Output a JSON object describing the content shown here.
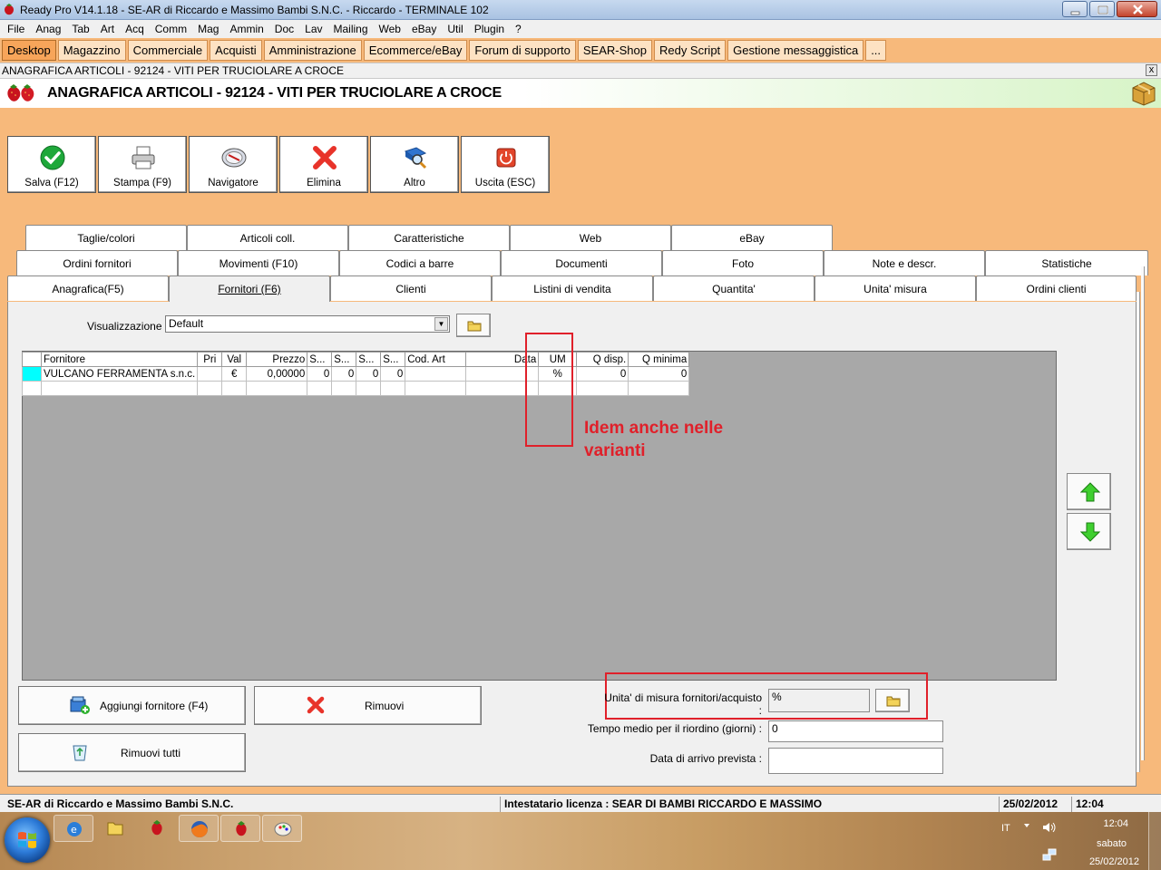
{
  "window": {
    "title": "Ready Pro V14.1.18 - SE-AR di Riccardo e Massimo Bambi S.N.C. - Riccardo - TERMINALE 102"
  },
  "menu": [
    "File",
    "Anag",
    "Tab",
    "Art",
    "Acq",
    "Comm",
    "Mag",
    "Ammin",
    "Doc",
    "Lav",
    "Mailing",
    "Web",
    "eBay",
    "Util",
    "Plugin",
    "?"
  ],
  "modules": [
    "Desktop",
    "Magazzino",
    "Commerciale",
    "Acquisti",
    "Amministrazione",
    "Ecommerce/eBay",
    "Forum di supporto",
    "SEAR-Shop",
    "Redy Script",
    "Gestione messaggistica",
    "..."
  ],
  "caption": {
    "text": "ANAGRAFICA ARTICOLI - 92124 - VITI PER TRUCIOLARE A CROCE",
    "close": "x"
  },
  "header": {
    "title": "ANAGRAFICA ARTICOLI - 92124 - VITI PER TRUCIOLARE A CROCE"
  },
  "toolbar": {
    "save": "Salva (F12)",
    "print": "Stampa (F9)",
    "navigator": "Navigatore",
    "delete": "Elimina",
    "other": "Altro",
    "exit": "Uscita (ESC)"
  },
  "tabs": {
    "row1": [
      "Taglie/colori",
      "Articoli coll.",
      "Caratteristiche",
      "Web",
      "eBay"
    ],
    "row2": [
      "Ordini fornitori",
      "Movimenti (F10)",
      "Codici a barre",
      "Documenti",
      "Foto",
      "Note e descr.",
      "Statistiche"
    ],
    "row3": [
      "Anagrafica(F5)",
      "Fornitori (F6)",
      "Clienti",
      "Listini di vendita",
      "Quantita'",
      "Unita' misura",
      "Ordini clienti"
    ]
  },
  "visualizzazione": {
    "label": "Visualizzazione :",
    "value": "Default",
    "arrow": "▼"
  },
  "grid": {
    "columns": [
      "Fornitore",
      "Pri",
      "Val",
      "Prezzo",
      "S...",
      "S...",
      "S...",
      "S...",
      "Cod. Art",
      "Data",
      "UM",
      "Q disp.",
      "Q minima"
    ],
    "rows": [
      [
        "VULCANO FERRAMENTA s.n.c.",
        "",
        "€",
        "0,00000",
        "0",
        "0",
        "0",
        "0",
        "",
        "",
        "%",
        "0",
        "0"
      ]
    ]
  },
  "annotation": {
    "line1": "Idem anche nelle",
    "line2": "varianti"
  },
  "buttons": {
    "add_supplier": "Aggiungi fornitore (F4)",
    "remove": "Rimuovi",
    "remove_all": "Rimuovi tutti"
  },
  "form": {
    "um_label": "Unita' di misura fornitori/acquisto :",
    "um_value": "%",
    "lead_label": "Tempo medio per il riordino (giorni) :",
    "lead_value": "0",
    "arrival_label": "Data di arrivo prevista :",
    "arrival_value": ""
  },
  "status": {
    "company": "SE-AR di Riccardo e Massimo Bambi S.N.C.",
    "license": "Intestatario licenza : SEAR DI BAMBI RICCARDO E MASSIMO",
    "date": "25/02/2012",
    "time": "12:04"
  },
  "taskbar": {
    "lang": "IT",
    "clock": "12:04",
    "day": "sabato",
    "date": "25/02/2012"
  },
  "colors": {
    "accent_orange": "#f7b97b",
    "annotation_red": "#e0202a",
    "selection_cyan": "#00ffff"
  }
}
